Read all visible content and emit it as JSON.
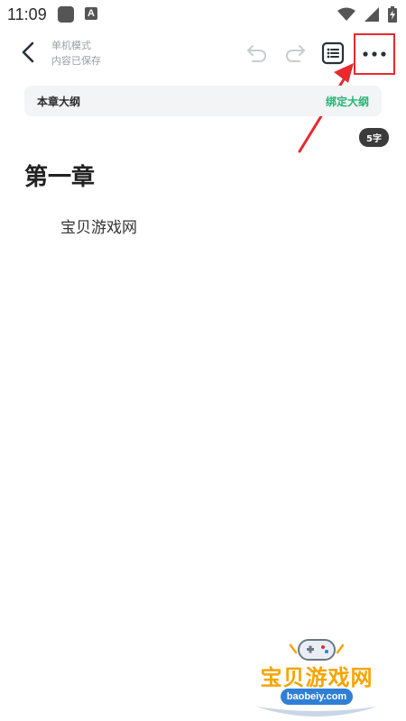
{
  "status_bar": {
    "time": "11:09",
    "notification_icons": [
      "app-square-icon",
      "a-icon"
    ],
    "right_icons": [
      "wifi-icon",
      "signal-icon",
      "battery-icon"
    ]
  },
  "header": {
    "mode_label": "单机模式",
    "save_status": "内容已保存",
    "icons": [
      "back-arrow-icon",
      "undo-icon",
      "redo-icon",
      "outline-list-icon",
      "more-icon"
    ]
  },
  "outline": {
    "label": "本章大纲",
    "action": "绑定大纲"
  },
  "editor": {
    "word_count": "5字",
    "chapter_title": "第一章",
    "chapter_text": "宝贝游戏网"
  },
  "watermark": {
    "title": "宝贝游戏网",
    "url": "baobeiy.com"
  },
  "colors": {
    "accent_green": "#22b573",
    "annotation_red": "#e8292e",
    "watermark_orange": "#f7a400",
    "watermark_blue": "#2f7fd6"
  }
}
